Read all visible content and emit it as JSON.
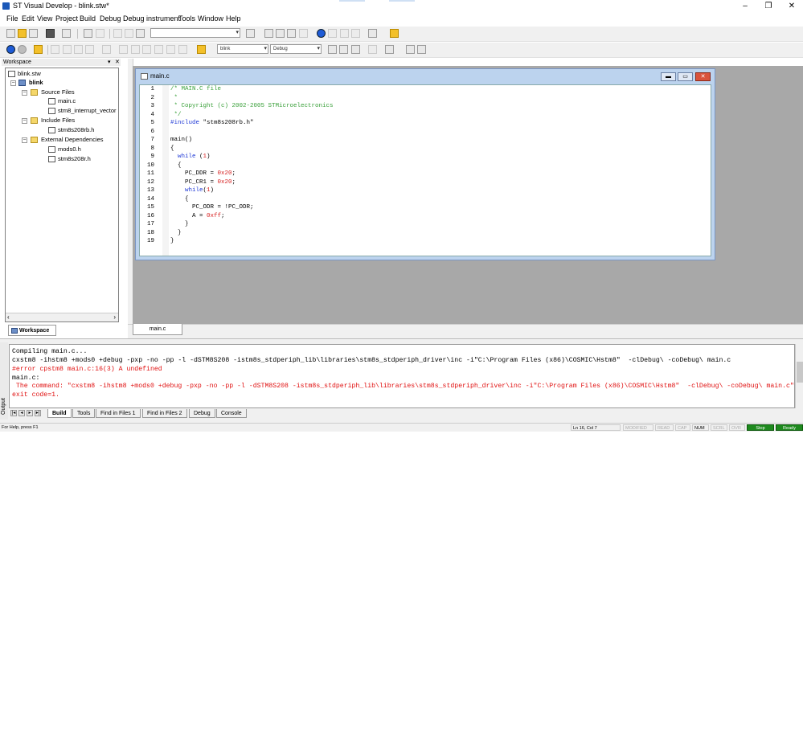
{
  "window": {
    "title": "ST Visual Develop - blink.stw*",
    "minimize": "–",
    "maximize": "❐",
    "close": "✕"
  },
  "menu": [
    "File",
    "Edit",
    "View",
    "Project",
    "Build",
    "Debug",
    "Debug instrument",
    "Tools",
    "Window",
    "Help"
  ],
  "toolbar": {
    "find_combo_value": "",
    "target_combo_value": "blink",
    "config_combo_value": "Debug"
  },
  "workspace": {
    "header": "Workspace",
    "tab_label": "Workspace",
    "tree": {
      "root": "blink.stw",
      "project": "blink",
      "source_folder": "Source Files",
      "source_files": [
        "main.c",
        "stm8_interrupt_vector"
      ],
      "include_folder": "Include Files",
      "include_files": [
        "stm8s208rb.h"
      ],
      "external_folder": "External Dependencies",
      "external_files": [
        "mods0.h",
        "stm8s208r.h"
      ]
    }
  },
  "editor": {
    "title": "main.c",
    "doc_tab": "main.c",
    "line_numbers": [
      "1",
      "2",
      "3",
      "4",
      "5",
      "6",
      "7",
      "8",
      "9",
      "10",
      "11",
      "12",
      "13",
      "14",
      "15",
      "16",
      "17",
      "18",
      "19"
    ],
    "lines": {
      "l1": "/* MAIN.C file",
      "l2": " *",
      "l3": " * Copyright (c) 2002-2005 STMicroelectronics",
      "l4": " */",
      "l5_kw": "#include",
      "l5_str": " \"stm8s208rb.h\"",
      "l7": "main()",
      "l8": "{",
      "l9_kw": "  while",
      "l9_a": " (",
      "l9_n": "1",
      "l9_b": ")",
      "l10": "  {",
      "l11_a": "    PC_DDR = ",
      "l11_n": "0x20",
      "l11_b": ";",
      "l12_a": "    PC_CR1 = ",
      "l12_n": "0x20",
      "l12_b": ";",
      "l13_kw": "    while",
      "l13_a": "(",
      "l13_n": "1",
      "l13_b": ")",
      "l14": "    {",
      "l15": "      PC_ODR = !PC_ODR;",
      "l16_a": "      A = ",
      "l16_n": "0xff",
      "l16_b": ";",
      "l17": "    }",
      "l18": "  }",
      "l19": "}"
    }
  },
  "output": {
    "side_label": "Output",
    "lines": [
      "Compiling main.c...",
      "cxstm8 -ihstm8 +mods0 +debug -pxp -no -pp -l -dSTM8S208 -istm8s_stdperiph_lib\\libraries\\stm8s_stdperiph_driver\\inc -i\"C:\\Program Files (x86)\\COSMIC\\Hstm8\"  -clDebug\\ -coDebug\\ main.c",
      "#error cpstm8 main.c:16(3) A undefined",
      "main.c:",
      " The command: \"cxstm8 -ihstm8 +mods0 +debug -pxp -no -pp -l -dSTM8S208 -istm8s_stdperiph_lib\\libraries\\stm8s_stdperiph_driver\\inc -i\"C:\\Program Files (x86)\\COSMIC\\Hstm8\"  -clDebug\\ -coDebug\\ main.c\" has failed, the returned value is: 1",
      "exit code=1."
    ],
    "tabs": [
      "Build",
      "Tools",
      "Find in Files 1",
      "Find in Files 2",
      "Debug",
      "Console"
    ],
    "active_tab": "Build"
  },
  "status": {
    "help": "For Help, press F1",
    "position": "Ln 16, Col 7",
    "modified": "MODIFIED",
    "read": "READ",
    "cap": "CAP",
    "num": "NUM",
    "scrl": "SCRL",
    "ovr": "OVR",
    "stop": "Stop",
    "ready": "Ready"
  }
}
